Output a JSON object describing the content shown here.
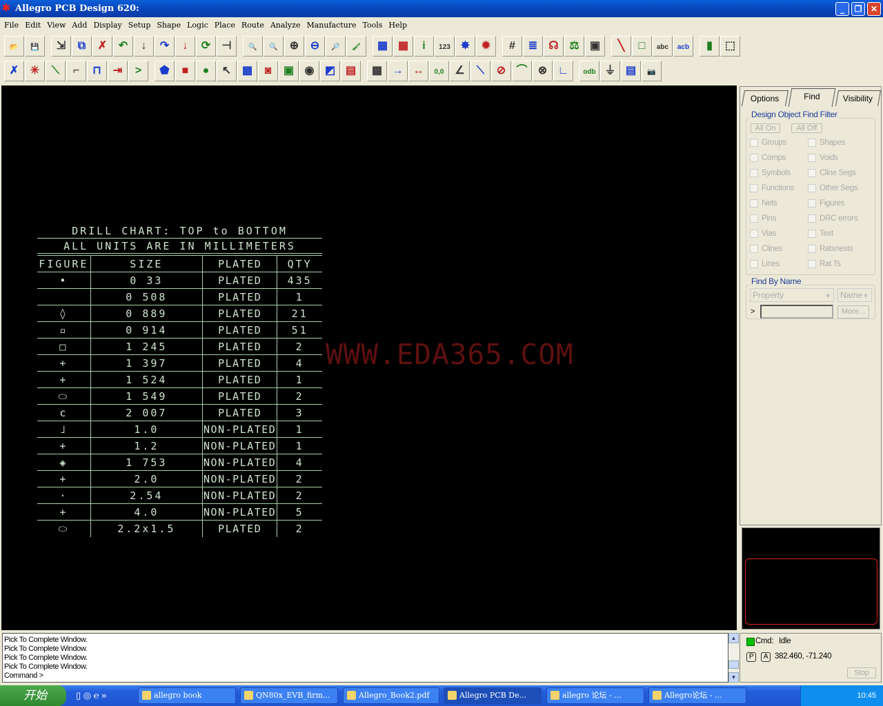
{
  "window": {
    "title": "Allegro PCB Design 620:",
    "controls": [
      "minimize",
      "maximize",
      "close"
    ]
  },
  "menu": [
    "File",
    "Edit",
    "View",
    "Add",
    "Display",
    "Setup",
    "Shape",
    "Logic",
    "Place",
    "Route",
    "Analyze",
    "Manufacture",
    "Tools",
    "Help"
  ],
  "toolbar1": [
    {
      "icon": "open-icon",
      "g": "📂"
    },
    {
      "icon": "save-icon",
      "g": "💾"
    },
    "sep",
    {
      "icon": "move-icon",
      "g": "⇲"
    },
    {
      "icon": "copy-icon",
      "g": "⧉"
    },
    {
      "icon": "delete-icon",
      "g": "✗"
    },
    {
      "icon": "undo-icon",
      "g": "↶"
    },
    {
      "icon": "undo-drop-icon",
      "g": "↓"
    },
    {
      "icon": "redo-icon",
      "g": "↷"
    },
    {
      "icon": "redo-drop-icon",
      "g": "↓"
    },
    {
      "icon": "spin-icon",
      "g": "⟳"
    },
    {
      "icon": "pin-icon",
      "g": "⊣"
    },
    "sep",
    {
      "icon": "zoom-window-icon",
      "g": "🔍"
    },
    {
      "icon": "zoom-fit-icon",
      "g": "🔍"
    },
    {
      "icon": "zoom-in-icon",
      "g": "⊕"
    },
    {
      "icon": "zoom-out-icon",
      "g": "⊖"
    },
    {
      "icon": "zoom-previous-icon",
      "g": "🔎"
    },
    {
      "icon": "redraw-icon",
      "g": "🖌"
    },
    "sep",
    {
      "icon": "color-icon",
      "g": "▦"
    },
    {
      "icon": "assign-color-icon",
      "g": "▦"
    },
    {
      "icon": "info-icon",
      "g": "i"
    },
    {
      "icon": "measure-icon",
      "g": "123"
    },
    {
      "icon": "highlight-icon",
      "g": "✸"
    },
    {
      "icon": "dehighlight-icon",
      "g": "✹"
    },
    "sep",
    {
      "icon": "grid-icon",
      "g": "#"
    },
    {
      "icon": "layers-icon",
      "g": "≣"
    },
    {
      "icon": "constraint-icon",
      "g": "☊"
    },
    {
      "icon": "balance-icon",
      "g": "⚖"
    },
    {
      "icon": "board-icon",
      "g": "▣"
    },
    "sep",
    {
      "icon": "add-line-icon",
      "g": "╲"
    },
    {
      "icon": "add-rect-icon",
      "g": "□"
    },
    {
      "icon": "add-text-icon",
      "g": "abc"
    },
    {
      "icon": "edit-text-icon",
      "g": "acb"
    },
    "sep",
    {
      "icon": "component-icon",
      "g": "▮"
    },
    {
      "icon": "dashed-rect-icon",
      "g": "⬚"
    }
  ],
  "toolbar2": [
    {
      "icon": "unroute-icon",
      "g": "✗"
    },
    {
      "icon": "ratsnest-icon",
      "g": "✳"
    },
    {
      "icon": "add-connect-icon",
      "g": "⟍"
    },
    {
      "icon": "slide-icon",
      "g": "⌐"
    },
    {
      "icon": "delay-tune-icon",
      "g": "⊓"
    },
    {
      "icon": "custom-smooth-icon",
      "g": "⇥"
    },
    {
      "icon": "vertex-icon",
      "g": ">"
    },
    "sep",
    {
      "icon": "shape-polygon-icon",
      "g": "⬟"
    },
    {
      "icon": "shape-rect-icon",
      "g": "■"
    },
    {
      "icon": "shape-circle-icon",
      "g": "●"
    },
    {
      "icon": "select-shape-icon",
      "g": "↖"
    },
    {
      "icon": "manual-void-icon",
      "g": "▩"
    },
    {
      "icon": "edit-boundary-icon",
      "g": "◙"
    },
    {
      "icon": "void-rect-icon",
      "g": "▣"
    },
    {
      "icon": "void-circle-icon",
      "g": "◉"
    },
    {
      "icon": "merge-shapes-icon",
      "g": "◩"
    },
    {
      "icon": "delete-islands-icon",
      "g": "▤"
    },
    "sep",
    {
      "icon": "dimension-icon",
      "g": "▦"
    },
    {
      "icon": "dim-linear-icon",
      "g": "→"
    },
    {
      "icon": "dim-parallel-icon",
      "g": "↔"
    },
    {
      "icon": "dim-datum-icon",
      "g": "0,0"
    },
    {
      "icon": "dim-angle-icon",
      "g": "∠"
    },
    {
      "icon": "chamfer-icon",
      "g": "⟍"
    },
    {
      "icon": "radius-icon",
      "g": "⊘"
    },
    {
      "icon": "fillet-icon",
      "g": "⌒"
    },
    {
      "icon": "diameter-icon",
      "g": "⊗"
    },
    {
      "icon": "angular-icon",
      "g": "∟"
    },
    "sep",
    {
      "icon": "odb-icon",
      "g": "odb"
    },
    {
      "icon": "drill-icon",
      "g": "⏚"
    },
    {
      "icon": "report-icon",
      "g": "▤"
    },
    {
      "icon": "camera-icon",
      "g": "📷"
    }
  ],
  "drill_chart": {
    "title": "DRILL CHART: TOP to BOTTOM",
    "subtitle": "ALL UNITS ARE IN MILLIMETERS",
    "headers": [
      "FIGURE",
      "SIZE",
      "PLATED",
      "QTY"
    ],
    "rows": [
      {
        "figure": "•",
        "size": "0 33",
        "plated": "PLATED",
        "qty": "435"
      },
      {
        "figure": "",
        "size": "0 508",
        "plated": "PLATED",
        "qty": "1"
      },
      {
        "figure": "◊",
        "size": "0 889",
        "plated": "PLATED",
        "qty": "21"
      },
      {
        "figure": "▫",
        "size": "0 914",
        "plated": "PLATED",
        "qty": "51"
      },
      {
        "figure": "□",
        "size": "1 245",
        "plated": "PLATED",
        "qty": "2"
      },
      {
        "figure": "+",
        "size": "1 397",
        "plated": "PLATED",
        "qty": "4"
      },
      {
        "figure": "+",
        "size": "1 524",
        "plated": "PLATED",
        "qty": "1"
      },
      {
        "figure": "⬭",
        "size": "1 549",
        "plated": "PLATED",
        "qty": "2"
      },
      {
        "figure": "c",
        "size": "2 007",
        "plated": "PLATED",
        "qty": "3"
      },
      {
        "figure": "˩",
        "size": "1.0",
        "plated": "NON-PLATED",
        "qty": "1"
      },
      {
        "figure": "+",
        "size": "1.2",
        "plated": "NON-PLATED",
        "qty": "1"
      },
      {
        "figure": "◈",
        "size": "1 753",
        "plated": "NON-PLATED",
        "qty": "4"
      },
      {
        "figure": "+",
        "size": "2.0",
        "plated": "NON-PLATED",
        "qty": "2"
      },
      {
        "figure": "·",
        "size": "2.54",
        "plated": "NON-PLATED",
        "qty": "2"
      },
      {
        "figure": "+",
        "size": "4.0",
        "plated": "NON-PLATED",
        "qty": "5"
      },
      {
        "figure": "⬭",
        "size": "2.2x1.5",
        "plated": "PLATED",
        "qty": "2"
      }
    ]
  },
  "watermark": "WWW.EDA365.COM",
  "panel": {
    "tabs": [
      "Options",
      "Find",
      "Visibility"
    ],
    "active_tab": "Find",
    "filter_title": "Design Object Find Filter",
    "all_on": "All On",
    "all_off": "All Off",
    "left": [
      "Groups",
      "Comps",
      "Symbols",
      "Functions",
      "Nets",
      "Pins",
      "Vias",
      "Clines",
      "Lines"
    ],
    "right": [
      "Shapes",
      "Voids",
      "Cline Segs",
      "Other Segs",
      "Figures",
      "DRC errors",
      "Text",
      "Ratsnests",
      "Rat Ts"
    ],
    "find_by_name": "Find By Name",
    "property": "Property",
    "name": "Name",
    "prompt": ">",
    "input_value": "",
    "more": "More..."
  },
  "console": {
    "lines": [
      "Pick To Complete Window.",
      "Pick To Complete Window.",
      "Pick To Complete Window.",
      "Pick To Complete Window.",
      "Command >"
    ]
  },
  "status": {
    "cmd_label": "Cmd:",
    "cmd_value": "Idle",
    "p": "P",
    "a": "A",
    "coords": "382.460, -71.240",
    "stop": "Stop",
    "idle_color": "#00c000"
  },
  "taskbar": {
    "start": "开始",
    "tasks": [
      "allegro book",
      "QN80x_EVB_firm...",
      "Allegro_Book2.pdf",
      "Allegro PCB De...",
      "allegro 论坛 - ...",
      "Allegro论坛 - ..."
    ],
    "active_task": 3,
    "clock": "10:45"
  }
}
